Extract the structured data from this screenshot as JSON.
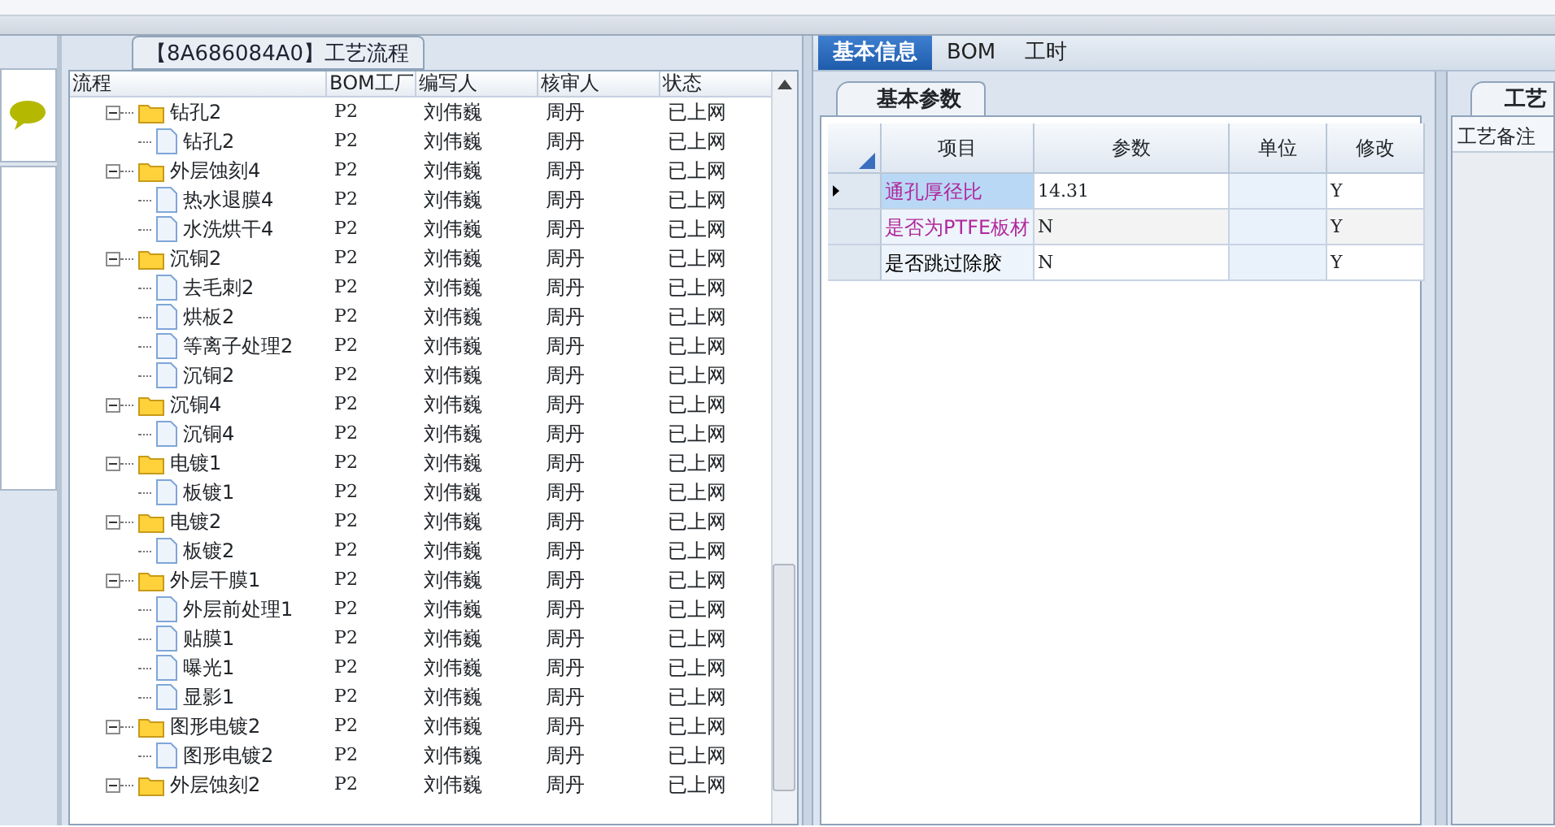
{
  "tree_panel": {
    "title": "【8A686084A0】工艺流程",
    "columns": [
      "流程",
      "BOM工厂",
      "编写人",
      "核审人",
      "状态"
    ],
    "nodes": [
      {
        "kind": "folder",
        "expanded": true,
        "name": "钻孔2",
        "factory": "P2",
        "writer": "刘伟巍",
        "reviewer": "周丹",
        "status": "已上网",
        "children": [
          {
            "kind": "step",
            "name": "钻孔2",
            "factory": "P2",
            "writer": "刘伟巍",
            "reviewer": "周丹",
            "status": "已上网"
          }
        ]
      },
      {
        "kind": "folder",
        "expanded": true,
        "name": "外层蚀刻4",
        "factory": "P2",
        "writer": "刘伟巍",
        "reviewer": "周丹",
        "status": "已上网",
        "children": [
          {
            "kind": "step",
            "name": "热水退膜4",
            "factory": "P2",
            "writer": "刘伟巍",
            "reviewer": "周丹",
            "status": "已上网"
          },
          {
            "kind": "step",
            "name": "水洗烘干4",
            "factory": "P2",
            "writer": "刘伟巍",
            "reviewer": "周丹",
            "status": "已上网"
          }
        ]
      },
      {
        "kind": "folder",
        "expanded": true,
        "name": "沉铜2",
        "factory": "P2",
        "writer": "刘伟巍",
        "reviewer": "周丹",
        "status": "已上网",
        "children": [
          {
            "kind": "step",
            "name": "去毛刺2",
            "factory": "P2",
            "writer": "刘伟巍",
            "reviewer": "周丹",
            "status": "已上网"
          },
          {
            "kind": "step",
            "name": "烘板2",
            "factory": "P2",
            "writer": "刘伟巍",
            "reviewer": "周丹",
            "status": "已上网"
          },
          {
            "kind": "step",
            "name": "等离子处理2",
            "factory": "P2",
            "writer": "刘伟巍",
            "reviewer": "周丹",
            "status": "已上网"
          },
          {
            "kind": "step",
            "name": "沉铜2",
            "factory": "P2",
            "writer": "刘伟巍",
            "reviewer": "周丹",
            "status": "已上网"
          }
        ]
      },
      {
        "kind": "folder",
        "expanded": true,
        "name": "沉铜4",
        "factory": "P2",
        "writer": "刘伟巍",
        "reviewer": "周丹",
        "status": "已上网",
        "children": [
          {
            "kind": "step",
            "name": "沉铜4",
            "factory": "P2",
            "writer": "刘伟巍",
            "reviewer": "周丹",
            "status": "已上网"
          }
        ]
      },
      {
        "kind": "folder",
        "expanded": true,
        "name": "电镀1",
        "factory": "P2",
        "writer": "刘伟巍",
        "reviewer": "周丹",
        "status": "已上网",
        "children": [
          {
            "kind": "step",
            "name": "板镀1",
            "factory": "P2",
            "writer": "刘伟巍",
            "reviewer": "周丹",
            "status": "已上网"
          }
        ]
      },
      {
        "kind": "folder",
        "expanded": true,
        "name": "电镀2",
        "factory": "P2",
        "writer": "刘伟巍",
        "reviewer": "周丹",
        "status": "已上网",
        "children": [
          {
            "kind": "step",
            "name": "板镀2",
            "factory": "P2",
            "writer": "刘伟巍",
            "reviewer": "周丹",
            "status": "已上网"
          }
        ]
      },
      {
        "kind": "folder",
        "expanded": true,
        "name": "外层干膜1",
        "factory": "P2",
        "writer": "刘伟巍",
        "reviewer": "周丹",
        "status": "已上网",
        "children": [
          {
            "kind": "step",
            "name": "外层前处理1",
            "factory": "P2",
            "writer": "刘伟巍",
            "reviewer": "周丹",
            "status": "已上网"
          },
          {
            "kind": "step",
            "name": "贴膜1",
            "factory": "P2",
            "writer": "刘伟巍",
            "reviewer": "周丹",
            "status": "已上网"
          },
          {
            "kind": "step",
            "name": "曝光1",
            "factory": "P2",
            "writer": "刘伟巍",
            "reviewer": "周丹",
            "status": "已上网"
          },
          {
            "kind": "step",
            "name": "显影1",
            "factory": "P2",
            "writer": "刘伟巍",
            "reviewer": "周丹",
            "status": "已上网"
          }
        ]
      },
      {
        "kind": "folder",
        "expanded": true,
        "name": "图形电镀2",
        "factory": "P2",
        "writer": "刘伟巍",
        "reviewer": "周丹",
        "status": "已上网",
        "children": [
          {
            "kind": "step",
            "name": "图形电镀2",
            "factory": "P2",
            "writer": "刘伟巍",
            "reviewer": "周丹",
            "status": "已上网"
          }
        ]
      },
      {
        "kind": "folder",
        "expanded": true,
        "name": "外层蚀刻2",
        "factory": "P2",
        "writer": "刘伟巍",
        "reviewer": "周丹",
        "status": "已上网"
      }
    ]
  },
  "detail_tabs": [
    {
      "label": "基本信息",
      "selected": true
    },
    {
      "label": "BOM",
      "selected": false
    },
    {
      "label": "工时",
      "selected": false
    }
  ],
  "params_panel": {
    "title": "基本参数",
    "columns": [
      "项目",
      "参数",
      "单位",
      "修改"
    ],
    "rows": [
      {
        "item": "通孔厚径比",
        "color": "#b0289c",
        "value": "14.31",
        "modify": "Y",
        "selected": true
      },
      {
        "item": "是否为PTFE板材",
        "color": "#b0289c",
        "value": "N",
        "modify": "Y",
        "selected": false
      },
      {
        "item": "是否跳过除胶",
        "color": "#000000",
        "value": "N",
        "modify": "Y",
        "selected": false
      }
    ]
  },
  "notes_panel": {
    "title": "工艺",
    "label": "工艺备注"
  }
}
